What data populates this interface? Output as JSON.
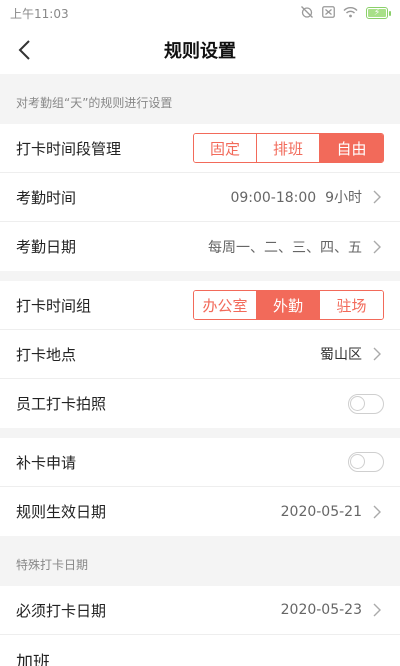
{
  "status": {
    "time": "上午11:03",
    "battery_bolt": "⚡"
  },
  "header": {
    "title": "规则设置"
  },
  "section1": {
    "caption": "对考勤组“天”的规则进行设置"
  },
  "group1": {
    "time_mgmt": {
      "label": "打卡时间段管理",
      "options": [
        "固定",
        "排班",
        "自由"
      ],
      "selected_index": 2
    },
    "attendance_time": {
      "label": "考勤时间",
      "value": "09:00-18:00  9小时"
    },
    "attendance_date": {
      "label": "考勤日期",
      "value": "每周一、二、三、四、五"
    }
  },
  "group2": {
    "time_group": {
      "label": "打卡时间组",
      "options": [
        "办公室",
        "外勤",
        "驻场"
      ],
      "selected_index": 1
    },
    "location": {
      "label": "打卡地点",
      "value": "蜀山区"
    },
    "photo": {
      "label": "员工打卡拍照",
      "enabled": false
    }
  },
  "group3": {
    "makeup": {
      "label": "补卡申请",
      "enabled": false
    },
    "effective_date": {
      "label": "规则生效日期",
      "value": "2020-05-21"
    }
  },
  "section2": {
    "caption": "特殊打卡日期"
  },
  "group4": {
    "must_date": {
      "label": "必须打卡日期",
      "value": "2020-05-23"
    },
    "overtime": {
      "label": "加班"
    }
  },
  "colors": {
    "accent": "#f26a5a"
  }
}
